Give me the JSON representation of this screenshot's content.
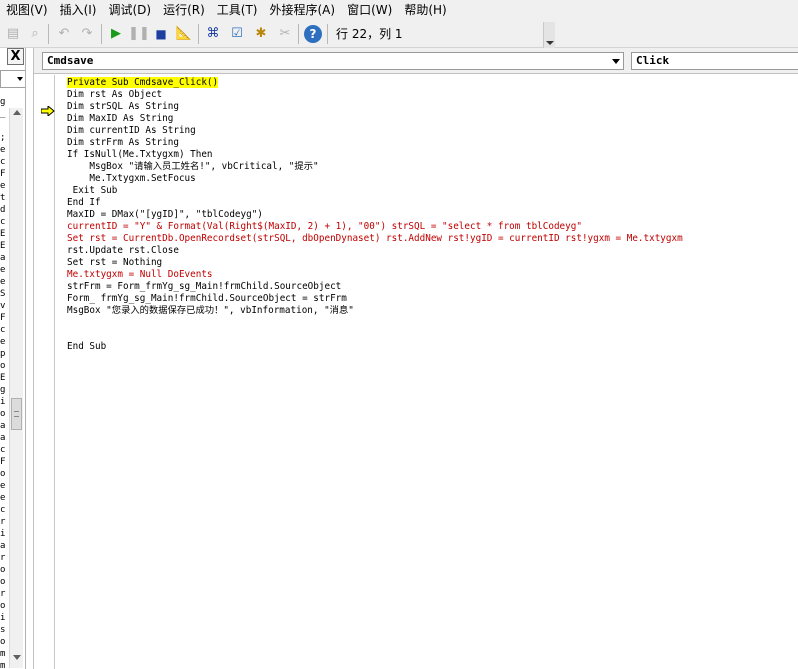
{
  "menu": [
    {
      "label": "视图(V)"
    },
    {
      "label": "插入(I)"
    },
    {
      "label": "调试(D)"
    },
    {
      "label": "运行(R)"
    },
    {
      "label": "工具(T)"
    },
    {
      "label": "外接程序(A)"
    },
    {
      "label": "窗口(W)"
    },
    {
      "label": "帮助(H)"
    }
  ],
  "toolbar": {
    "position_label": "行 22，列 1"
  },
  "left_panel": {
    "close_label": "X",
    "fragments": [
      "g",
      "_",
      "",
      ";",
      "e",
      "c",
      "F",
      "e",
      "t",
      "d",
      "c",
      "E",
      "E",
      "a",
      "e",
      "e",
      "S",
      "v",
      "F",
      "c",
      "e",
      "p",
      "o",
      "E",
      "g",
      "i",
      "o",
      "a",
      "a",
      "c",
      "F",
      "o",
      "e",
      "e",
      "c",
      "r",
      "i",
      "a",
      "r",
      "o",
      "o",
      "r",
      "o",
      "i",
      "s",
      "o",
      "m",
      "m"
    ]
  },
  "code_window": {
    "object_combo": "Cmdsave",
    "procedure_combo": "Click",
    "lines": [
      {
        "text": "Private Sub Cmdsave_Click()",
        "style": "hl"
      },
      {
        "text": "Dim rst As Object",
        "style": "normal"
      },
      {
        "text": "Dim strSQL As String",
        "style": "normal"
      },
      {
        "text": "Dim MaxID As String",
        "style": "normal"
      },
      {
        "text": "Dim currentID As String",
        "style": "normal"
      },
      {
        "text": "Dim strFrm As String",
        "style": "normal"
      },
      {
        "text": "If IsNull(Me.Txtygxm) Then",
        "style": "normal"
      },
      {
        "text": "    MsgBox \"请输入员工姓名!\", vbCritical, \"提示\"",
        "style": "normal"
      },
      {
        "text": "    Me.Txtygxm.SetFocus",
        "style": "normal"
      },
      {
        "text": " Exit Sub",
        "style": "normal"
      },
      {
        "text": "End If",
        "style": "normal"
      },
      {
        "text": "MaxID = DMax(\"[ygID]\", \"tblCodeyg\")",
        "style": "normal"
      },
      {
        "text": "currentID = \"Y\" & Format(Val(Right$(MaxID, 2) + 1), \"00\") strSQL = \"select * from tblCodeyg\"",
        "style": "red"
      },
      {
        "text": "Set rst = CurrentDb.OpenRecordset(strSQL, dbOpenDynaset) rst.AddNew rst!ygID = currentID rst!ygxm = Me.txtygxm",
        "style": "red"
      },
      {
        "text": "rst.Update rst.Close",
        "style": "normal"
      },
      {
        "text": "Set rst = Nothing",
        "style": "normal"
      },
      {
        "text": "Me.txtygxm = Null DoEvents",
        "style": "red"
      },
      {
        "text": "strFrm = Form_frmYg_sg_Main!frmChild.SourceObject",
        "style": "normal"
      },
      {
        "text": "Form_ frmYg_sg_Main!frmChild.SourceObject = strFrm",
        "style": "normal"
      },
      {
        "text": "MsgBox \"您录入的数据保存已成功！\", vbInformation, \"消息\"",
        "style": "normal"
      },
      {
        "text": "",
        "style": "blank"
      },
      {
        "text": "",
        "style": "blank"
      },
      {
        "text": "End Sub",
        "style": "normal"
      }
    ]
  }
}
